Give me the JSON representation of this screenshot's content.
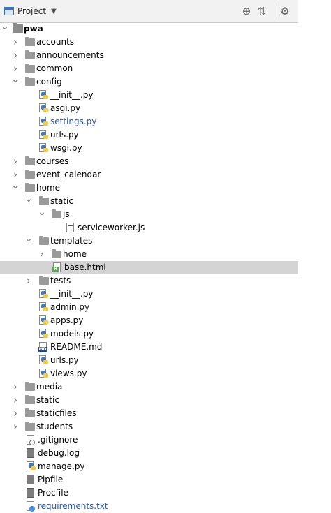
{
  "header": {
    "title": "Project",
    "caret": "▼",
    "tools": [
      {
        "name": "locate-icon",
        "glyph": "⊕"
      },
      {
        "name": "collapse-all-icon",
        "glyph": "⇅"
      },
      {
        "name": "settings-gear-icon",
        "glyph": "⚙"
      }
    ]
  },
  "tree": [
    {
      "label": "pwa",
      "depth": 0,
      "type": "root",
      "expanded": true,
      "bold": true
    },
    {
      "label": "accounts",
      "depth": 1,
      "type": "folder",
      "expanded": false
    },
    {
      "label": "announcements",
      "depth": 1,
      "type": "folder",
      "expanded": false
    },
    {
      "label": "common",
      "depth": 1,
      "type": "folder",
      "expanded": false
    },
    {
      "label": "config",
      "depth": 1,
      "type": "folder",
      "expanded": true
    },
    {
      "label": "__init__.py",
      "depth": 2,
      "type": "py"
    },
    {
      "label": "asgi.py",
      "depth": 2,
      "type": "py"
    },
    {
      "label": "settings.py",
      "depth": 2,
      "type": "py",
      "modified": true
    },
    {
      "label": "urls.py",
      "depth": 2,
      "type": "py"
    },
    {
      "label": "wsgi.py",
      "depth": 2,
      "type": "py"
    },
    {
      "label": "courses",
      "depth": 1,
      "type": "folder",
      "expanded": false
    },
    {
      "label": "event_calendar",
      "depth": 1,
      "type": "folder",
      "expanded": false
    },
    {
      "label": "home",
      "depth": 1,
      "type": "folder",
      "expanded": true
    },
    {
      "label": "static",
      "depth": 2,
      "type": "folder",
      "expanded": true
    },
    {
      "label": "js",
      "depth": 3,
      "type": "folder",
      "expanded": true
    },
    {
      "label": "serviceworker.js",
      "depth": 4,
      "type": "js"
    },
    {
      "label": "templates",
      "depth": 2,
      "type": "folder",
      "expanded": true
    },
    {
      "label": "home",
      "depth": 3,
      "type": "folder",
      "expanded": false
    },
    {
      "label": "base.html",
      "depth": 3,
      "type": "html",
      "selected": true
    },
    {
      "label": "tests",
      "depth": 2,
      "type": "folder",
      "expanded": false
    },
    {
      "label": "__init__.py",
      "depth": 2,
      "type": "py"
    },
    {
      "label": "admin.py",
      "depth": 2,
      "type": "py"
    },
    {
      "label": "apps.py",
      "depth": 2,
      "type": "py"
    },
    {
      "label": "models.py",
      "depth": 2,
      "type": "py"
    },
    {
      "label": "README.md",
      "depth": 2,
      "type": "md"
    },
    {
      "label": "urls.py",
      "depth": 2,
      "type": "py"
    },
    {
      "label": "views.py",
      "depth": 2,
      "type": "py"
    },
    {
      "label": "media",
      "depth": 1,
      "type": "folder",
      "expanded": false
    },
    {
      "label": "static",
      "depth": 1,
      "type": "folder",
      "expanded": false
    },
    {
      "label": "staticfiles",
      "depth": 1,
      "type": "folder",
      "expanded": false
    },
    {
      "label": "students",
      "depth": 1,
      "type": "folder",
      "expanded": false
    },
    {
      "label": ".gitignore",
      "depth": 1,
      "type": "git"
    },
    {
      "label": "debug.log",
      "depth": 1,
      "type": "log"
    },
    {
      "label": "manage.py",
      "depth": 1,
      "type": "py"
    },
    {
      "label": "Pipfile",
      "depth": 1,
      "type": "log"
    },
    {
      "label": "Procfile",
      "depth": 1,
      "type": "plain"
    },
    {
      "label": "requirements.txt",
      "depth": 1,
      "type": "req",
      "modified": true
    }
  ],
  "colors": {
    "header_bg": "#f2f2f2",
    "selected_bg": "#d4d4d4",
    "modified_text": "#2a56c6"
  }
}
